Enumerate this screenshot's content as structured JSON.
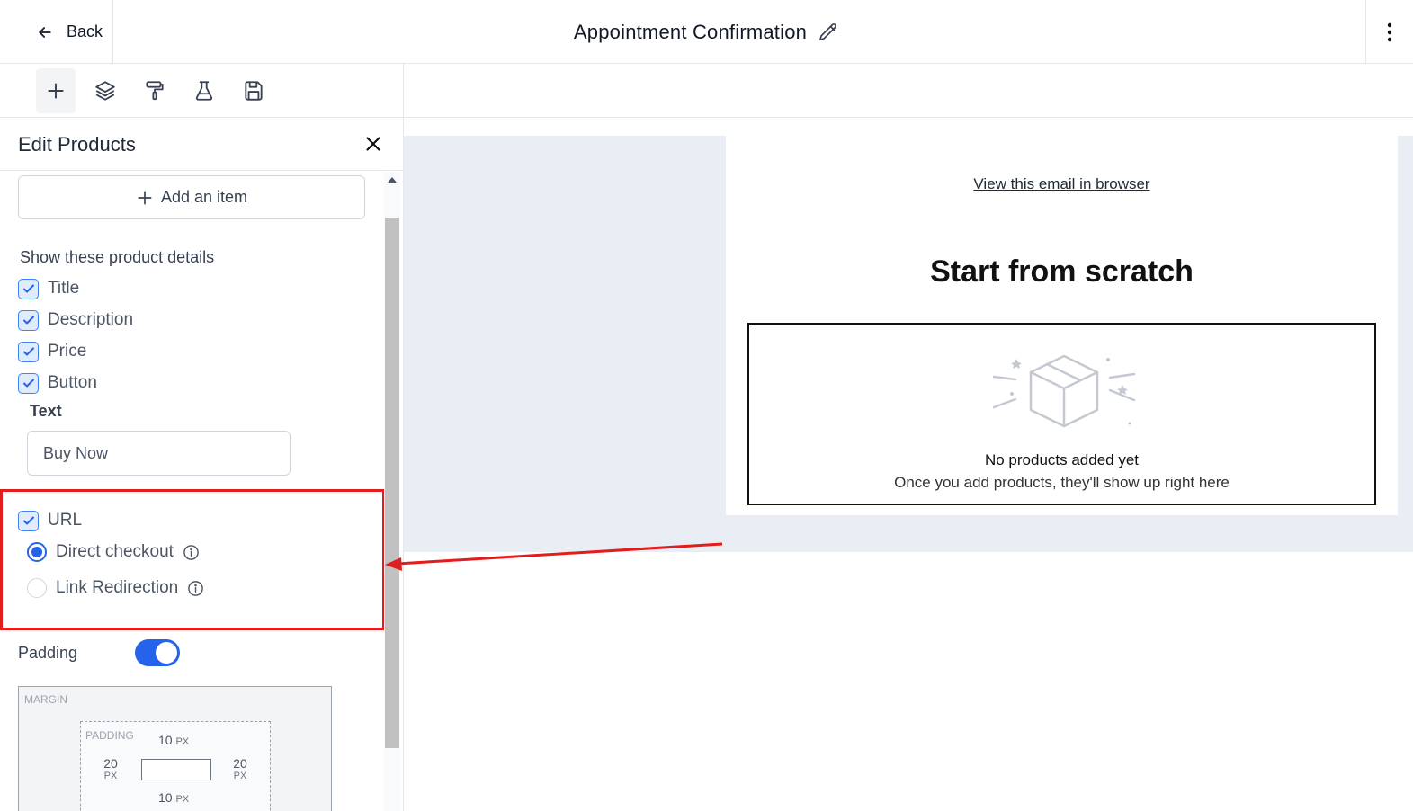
{
  "header": {
    "back_label": "Back",
    "title": "Appointment Confirmation"
  },
  "toolbar": {
    "tools": [
      "add-icon",
      "layers-icon",
      "paint-roller-icon",
      "flask-icon",
      "save-icon"
    ],
    "active": "add-icon"
  },
  "panel": {
    "title": "Edit Products",
    "add_item_label": "Add an item",
    "details_heading": "Show these product details",
    "details": [
      {
        "label": "Title",
        "checked": true
      },
      {
        "label": "Description",
        "checked": true
      },
      {
        "label": "Price",
        "checked": true
      },
      {
        "label": "Button",
        "checked": true
      }
    ],
    "button_text_label": "Text",
    "button_text_value": "Buy Now",
    "url": {
      "label": "URL",
      "checked": true,
      "options": [
        {
          "label": "Direct checkout",
          "selected": true
        },
        {
          "label": "Link Redirection",
          "selected": false
        }
      ]
    },
    "padding_label": "Padding",
    "padding_enabled": true,
    "spacing": {
      "margin_label": "MARGIN",
      "padding_label": "PADDING",
      "top": "10",
      "bottom": "10",
      "left": "20",
      "right": "20",
      "unit": "PX"
    }
  },
  "email": {
    "view_link": "View this email in browser",
    "heading": "Start from scratch",
    "empty_title": "No products added yet",
    "empty_subtitle": "Once you add products, they'll show up right here"
  },
  "colors": {
    "accent": "#2563eb",
    "highlight": "#e11d1d",
    "canvas_bg": "#e9eef5"
  }
}
